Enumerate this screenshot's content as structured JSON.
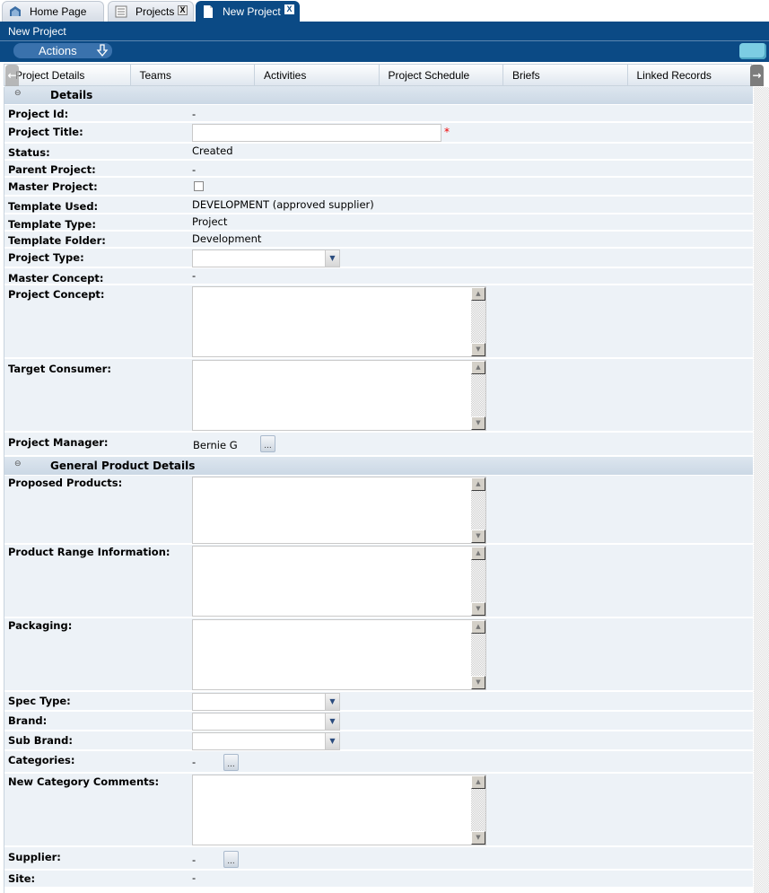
{
  "window_tabs": [
    {
      "label": "Home Page",
      "icon": "home-icon",
      "closable": false
    },
    {
      "label": "Projects",
      "icon": "list-icon",
      "closable": true
    },
    {
      "label": "New Project",
      "icon": "document-icon",
      "closable": true,
      "active": true
    }
  ],
  "close_glyph": "X",
  "header": {
    "title": "New Project",
    "actions_label": "Actions"
  },
  "sub_tabs": [
    "Project Details",
    "Teams",
    "Activities",
    "Project Schedule",
    "Briefs",
    "Linked Records"
  ],
  "sections": {
    "details": {
      "title": "Details",
      "toggle": "⊖"
    },
    "general": {
      "title": "General Product Details",
      "toggle": "⊖"
    }
  },
  "fields": {
    "project_id": {
      "label": "Project Id:",
      "value": "-"
    },
    "project_title": {
      "label": "Project Title:",
      "value": "",
      "required_marker": "*"
    },
    "status": {
      "label": "Status:",
      "value": "Created"
    },
    "parent_project": {
      "label": "Parent Project:",
      "value": "-"
    },
    "master_project": {
      "label": "Master Project:",
      "checked": false
    },
    "template_used": {
      "label": "Template Used:",
      "value": "DEVELOPMENT (approved supplier)"
    },
    "template_type": {
      "label": "Template Type:",
      "value": "Project"
    },
    "template_folder": {
      "label": "Template Folder:",
      "value": "Development"
    },
    "project_type": {
      "label": "Project Type:",
      "value": ""
    },
    "master_concept": {
      "label": "Master Concept:",
      "value": "-"
    },
    "project_concept": {
      "label": "Project Concept:",
      "value": ""
    },
    "target_consumer": {
      "label": "Target Consumer:",
      "value": ""
    },
    "project_manager": {
      "label": "Project Manager:",
      "value": "Bernie G"
    },
    "proposed_products": {
      "label": "Proposed Products:",
      "value": ""
    },
    "product_range_information": {
      "label": "Product Range Information:",
      "value": ""
    },
    "packaging": {
      "label": "Packaging:",
      "value": ""
    },
    "spec_type": {
      "label": "Spec Type:",
      "value": ""
    },
    "brand": {
      "label": "Brand:",
      "value": ""
    },
    "sub_brand": {
      "label": "Sub Brand:",
      "value": ""
    },
    "categories": {
      "label": "Categories:",
      "value": "-"
    },
    "new_category_comments": {
      "label": "New Category Comments:",
      "value": ""
    },
    "supplier": {
      "label": "Supplier:",
      "value": "-"
    },
    "site": {
      "label": "Site:",
      "value": "-"
    }
  },
  "lookup_glyph": "...",
  "colors": {
    "header": "#0b4a85",
    "row_bg": "#edf2f7",
    "section_bg": "#cbd8e5",
    "required": "#e00000"
  }
}
